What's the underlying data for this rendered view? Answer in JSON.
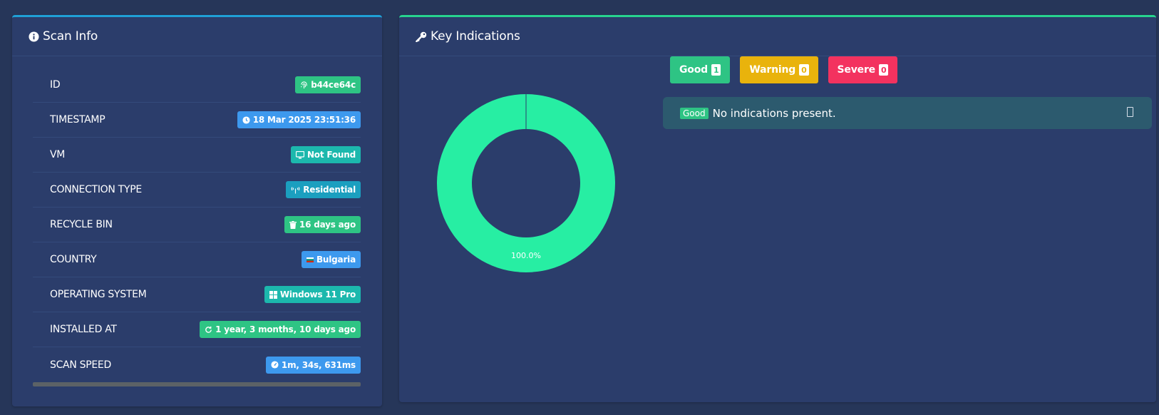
{
  "scan_info": {
    "title": "Scan Info",
    "header_icon": "info-icon",
    "rows": [
      {
        "label": "ID",
        "value": "b44ce64c",
        "icon": "fingerprint-icon",
        "color": "#2ec484"
      },
      {
        "label": "TIMESTAMP",
        "value": "18 Mar 2025 23:51:36",
        "icon": "clock-icon",
        "color": "#3d99ee"
      },
      {
        "label": "VM",
        "value": "Not Found",
        "icon": "monitor-icon",
        "color": "#1cb8ad"
      },
      {
        "label": "CONNECTION TYPE",
        "value": "Residential",
        "icon": "tower-icon",
        "color": "#1b9fbf"
      },
      {
        "label": "RECYCLE BIN",
        "value": "16 days ago",
        "icon": "trash-icon",
        "color": "#2ec484"
      },
      {
        "label": "COUNTRY",
        "value": "Bulgaria",
        "icon": "flag-icon",
        "color": "#3d99ee"
      },
      {
        "label": "OPERATING SYSTEM",
        "value": "Windows 11 Pro",
        "icon": "windows-icon",
        "color": "#1cb8ad"
      },
      {
        "label": "INSTALLED AT",
        "value": "1 year, 3 months, 10 days ago",
        "icon": "refresh-icon",
        "color": "#2ec484"
      },
      {
        "label": "SCAN SPEED",
        "value": "1m, 34s, 631ms",
        "icon": "gauge-icon",
        "color": "#3d99ee"
      }
    ]
  },
  "key_indications": {
    "title": "Key Indications",
    "header_icon": "key-icon",
    "filters": [
      {
        "label": "Good",
        "count": "1",
        "color": "#2ec484"
      },
      {
        "label": "Warning",
        "count": "0",
        "color": "#e9b30c"
      },
      {
        "label": "Severe",
        "count": "0",
        "color": "#f3325f"
      }
    ],
    "alert": {
      "tag": "Good",
      "message": "No indications present."
    }
  },
  "chart_data": {
    "type": "pie",
    "categories": [
      "Good"
    ],
    "values": [
      100
    ],
    "label": "100.0%",
    "colors": [
      "#27eea3"
    ]
  }
}
